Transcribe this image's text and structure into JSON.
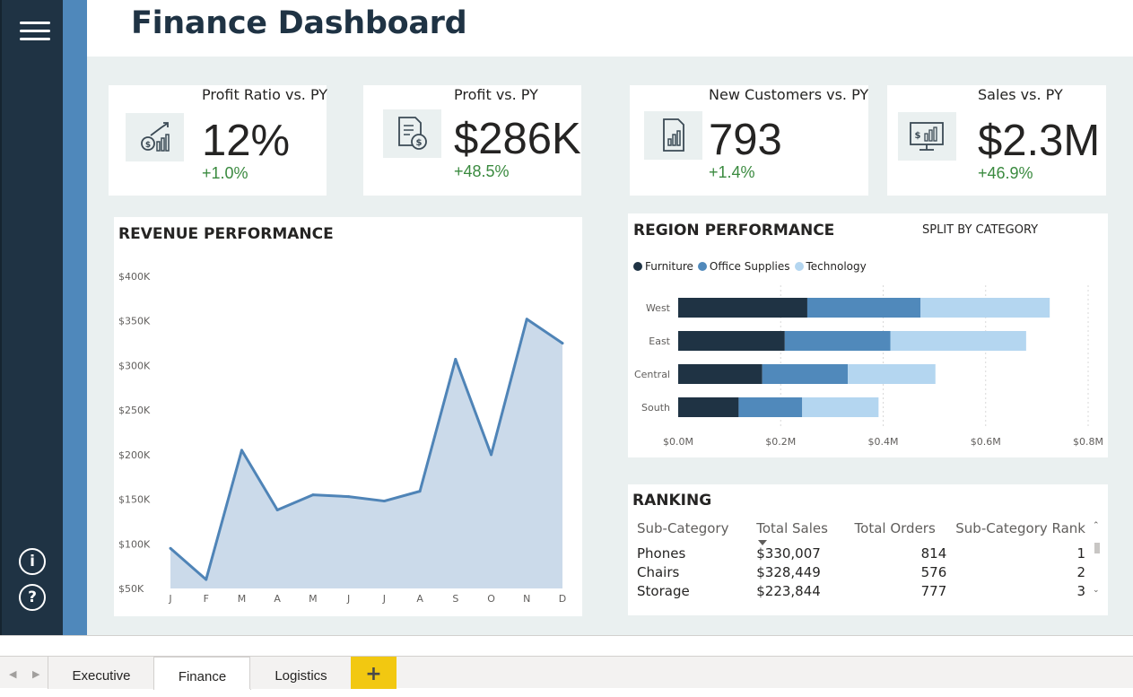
{
  "page": {
    "title": "Finance Dashboard"
  },
  "nav": {
    "menu_icon": "hamburger-menu-icon",
    "info_icon": "info-circle-icon",
    "help_icon": "question-circle-icon"
  },
  "kpis": [
    {
      "title": "Profit Ratio vs. PY",
      "value": "12%",
      "delta": "+1.0%",
      "icon": "chart-growth-coin-icon"
    },
    {
      "title": "Profit vs. PY",
      "value": "$286K",
      "delta": "+48.5%",
      "icon": "invoice-dollar-icon"
    },
    {
      "title": "New Customers vs. PY",
      "value": "793",
      "delta": "+1.4%",
      "icon": "document-chart-icon"
    },
    {
      "title": "Sales vs. PY",
      "value": "$2.3M",
      "delta": "+46.9%",
      "icon": "monitor-dollar-chart-icon"
    }
  ],
  "revenue": {
    "title": "REVENUE PERFORMANCE"
  },
  "region": {
    "title": "REGION PERFORMANCE",
    "subtitle": "SPLIT BY CATEGORY"
  },
  "ranking": {
    "title": "RANKING",
    "columns": [
      "Sub-Category",
      "Total Sales",
      "Total Orders",
      "Sub-Category Rank"
    ],
    "rows": [
      [
        "Phones",
        "$330,007",
        "814",
        "1"
      ],
      [
        "Chairs",
        "$328,449",
        "576",
        "2"
      ],
      [
        "Storage",
        "$223,844",
        "777",
        "3"
      ]
    ]
  },
  "tabs": {
    "items": [
      "Executive",
      "Finance",
      "Logistics"
    ],
    "active": "Finance",
    "add_label": "+"
  },
  "colors": {
    "rail_dark": "#1f3344",
    "rail_blue": "#4f88bb",
    "furniture": "#1f3344",
    "office_supplies": "#5089bb",
    "technology": "#b4d6f0",
    "positive": "#3a8a3f",
    "area_fill": "#cbdaea",
    "area_line": "#4f84b7",
    "add_tab": "#f2c811"
  },
  "chart_data": [
    {
      "type": "area",
      "x": [
        "J",
        "F",
        "M",
        "A",
        "M",
        "J",
        "J",
        "A",
        "S",
        "O",
        "N",
        "D"
      ],
      "values": [
        95000,
        60000,
        205000,
        138000,
        155000,
        153000,
        148000,
        159000,
        307000,
        200000,
        352000,
        325000
      ],
      "ylim": [
        50000,
        400000
      ],
      "yticks": [
        "$400K",
        "$350K",
        "$300K",
        "$250K",
        "$200K",
        "$150K",
        "$100K",
        "$50K"
      ],
      "ytick_values": [
        400000,
        350000,
        300000,
        250000,
        200000,
        150000,
        100000,
        50000
      ]
    },
    {
      "type": "bar",
      "orientation": "horizontal",
      "stacked": true,
      "categories": [
        "West",
        "East",
        "Central",
        "South"
      ],
      "series": [
        {
          "name": "Furniture",
          "values": [
            0.252,
            0.208,
            0.164,
            0.118
          ]
        },
        {
          "name": "Office Supplies",
          "values": [
            0.221,
            0.206,
            0.167,
            0.124
          ]
        },
        {
          "name": "Technology",
          "values": [
            0.252,
            0.265,
            0.171,
            0.149
          ]
        }
      ],
      "xlim": [
        0,
        0.8
      ],
      "xticks": [
        "$0.0M",
        "$0.2M",
        "$0.4M",
        "$0.6M",
        "$0.8M"
      ],
      "xtick_values": [
        0,
        0.2,
        0.4,
        0.6,
        0.8
      ],
      "legend": "top-left"
    }
  ]
}
